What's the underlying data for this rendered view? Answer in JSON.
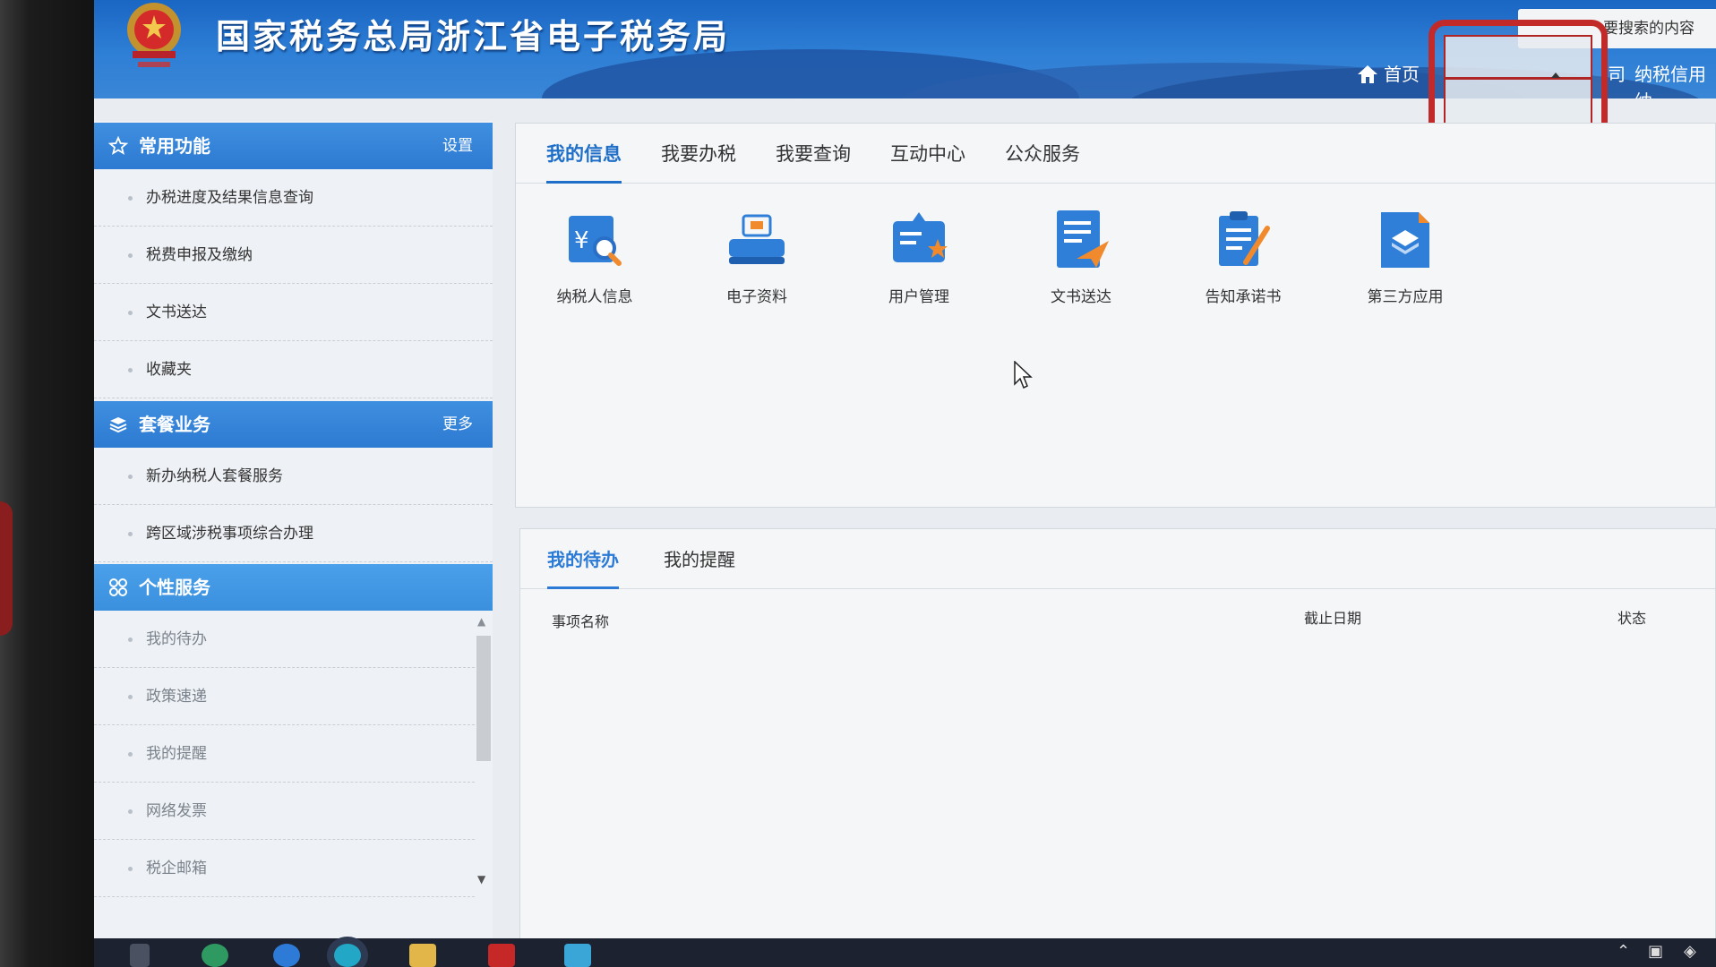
{
  "header": {
    "title": "国家税务总局浙江省电子税务局",
    "search_placeholder": "要搜索的内容",
    "nav_home": "首页",
    "nav_partial": "司",
    "nav_credit": "纳税信用纳"
  },
  "sidebar": {
    "common": {
      "title": "常用功能",
      "action": "设置",
      "items": [
        {
          "label": "办税进度及结果信息查询"
        },
        {
          "label": "税费申报及缴纳"
        },
        {
          "label": "文书送达"
        },
        {
          "label": "收藏夹"
        }
      ]
    },
    "package": {
      "title": "套餐业务",
      "action": "更多",
      "items": [
        {
          "label": "新办纳税人套餐服务"
        },
        {
          "label": "跨区域涉税事项综合办理"
        }
      ]
    },
    "personal": {
      "title": "个性服务",
      "items": [
        {
          "label": "我的待办"
        },
        {
          "label": "政策速递"
        },
        {
          "label": "我的提醒"
        },
        {
          "label": "网络发票"
        },
        {
          "label": "税企邮箱"
        }
      ]
    }
  },
  "main": {
    "tabs": [
      {
        "label": "我的信息"
      },
      {
        "label": "我要办税"
      },
      {
        "label": "我要查询"
      },
      {
        "label": "互动中心"
      },
      {
        "label": "公众服务"
      }
    ],
    "apps": [
      {
        "label": "纳税人信息",
        "icon": "taxpayer-info-icon"
      },
      {
        "label": "电子资料",
        "icon": "electronic-data-icon"
      },
      {
        "label": "用户管理",
        "icon": "user-management-icon"
      },
      {
        "label": "文书送达",
        "icon": "document-delivery-icon"
      },
      {
        "label": "告知承诺书",
        "icon": "commitment-letter-icon"
      },
      {
        "label": "第三方应用",
        "icon": "third-party-app-icon"
      }
    ]
  },
  "todo": {
    "tabs": [
      {
        "label": "我的待办"
      },
      {
        "label": "我的提醒"
      }
    ],
    "columns": {
      "name": "事项名称",
      "deadline": "截止日期",
      "status": "状态"
    }
  },
  "colors": {
    "header_blue": "#2e7fd6",
    "accent": "#1f6fc9",
    "highlight_red": "#c22a2a"
  }
}
